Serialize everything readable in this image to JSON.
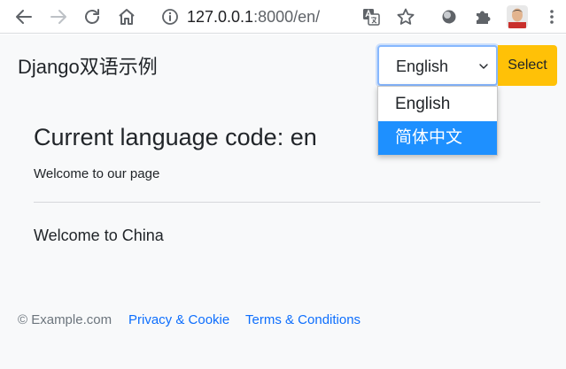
{
  "browser": {
    "url_host": "127.0.0.1",
    "url_path": ":8000/en/",
    "icons": [
      "back-arrow-icon",
      "forward-arrow-icon",
      "reload-icon",
      "home-icon",
      "info-icon",
      "translate-icon",
      "star-icon",
      "extension-circle-icon",
      "puzzle-icon",
      "profile-avatar",
      "menu-dots-icon"
    ]
  },
  "page": {
    "brand": "Django双语示例",
    "language_select": {
      "value": "English",
      "options": [
        "English",
        "简体中文"
      ],
      "highlighted": "简体中文"
    },
    "select_button": "Select",
    "heading": "Current language code: en",
    "welcome_page": "Welcome to our page",
    "welcome_china": "Welcome to China",
    "footer": {
      "copyright": "© Example.com",
      "privacy": "Privacy & Cookie",
      "terms": "Terms & Conditions"
    }
  },
  "colors": {
    "accent_button": "#ffc107",
    "option_highlight": "#1e90ff",
    "link": "#0d6efd",
    "page_background": "#f8f9fa"
  }
}
